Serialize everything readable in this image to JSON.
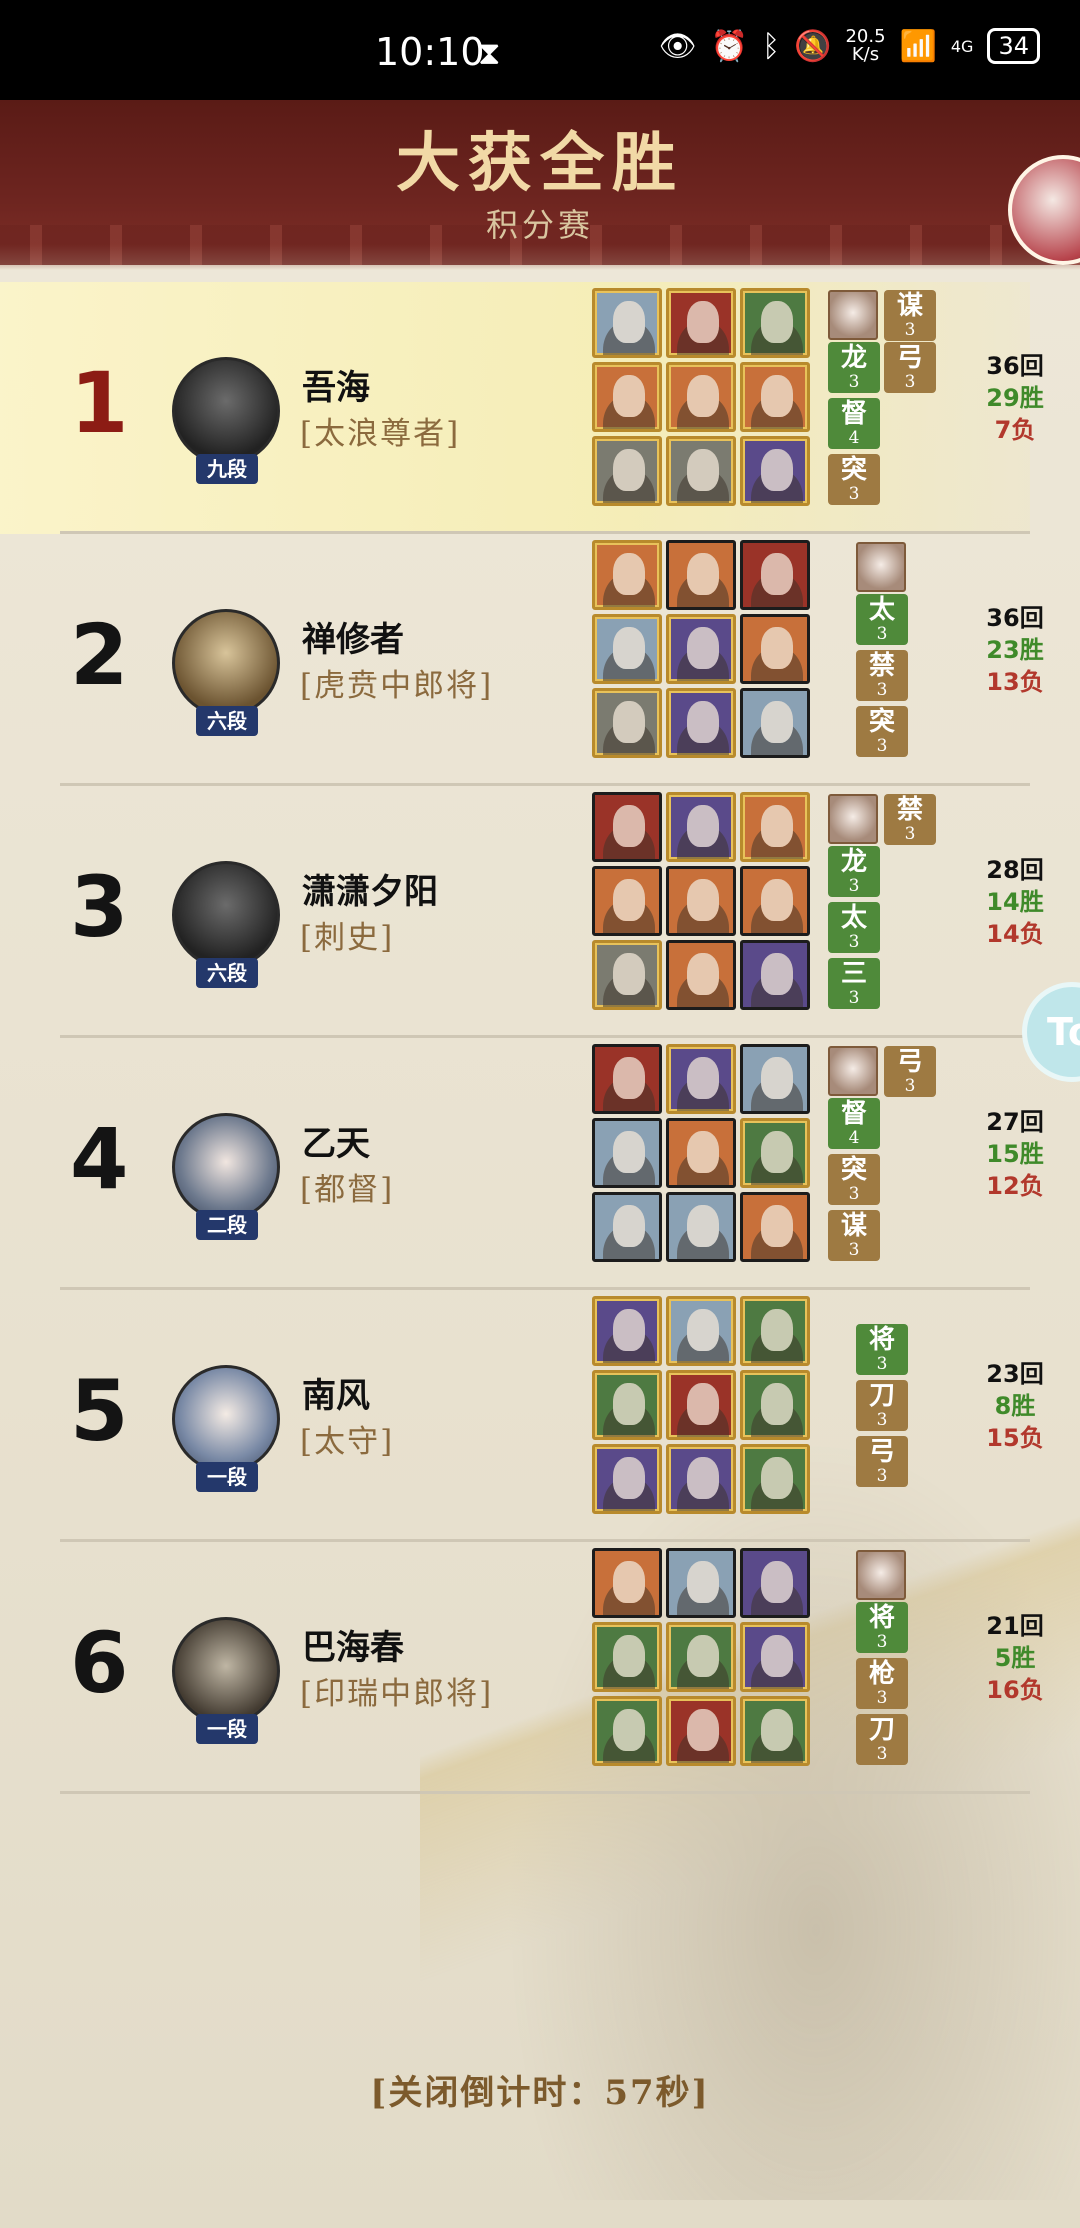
{
  "status_bar": {
    "time": "10:10",
    "net_speed_top": "20.5",
    "net_speed_bottom": "K/s",
    "signal": "4G",
    "battery": "34"
  },
  "header": {
    "title": "大获全胜",
    "subtitle": "积分赛"
  },
  "players": [
    {
      "rank": "1",
      "name": "吾海",
      "title": "[太浪尊者]",
      "dan": "九段",
      "rounds": "36回",
      "wins": "29胜",
      "losses": "7负",
      "tags": [
        {
          "label": "谋",
          "count": "3",
          "color": "brown"
        },
        {
          "label": "弓",
          "count": "3",
          "color": "brown"
        },
        {
          "label": "龙",
          "count": "3",
          "color": "green"
        },
        {
          "label": "督",
          "count": "4",
          "color": "green"
        },
        {
          "label": "突",
          "count": "3",
          "color": "brown"
        }
      ]
    },
    {
      "rank": "2",
      "name": "禅修者",
      "title": "[虎贲中郎将]",
      "dan": "六段",
      "rounds": "36回",
      "wins": "23胜",
      "losses": "13负",
      "tags": [
        {
          "label": "太",
          "count": "3",
          "color": "green"
        },
        {
          "label": "禁",
          "count": "3",
          "color": "brown"
        },
        {
          "label": "突",
          "count": "3",
          "color": "brown"
        }
      ]
    },
    {
      "rank": "3",
      "name": "潇潇夕阳",
      "title": "[刺史]",
      "dan": "六段",
      "rounds": "28回",
      "wins": "14胜",
      "losses": "14负",
      "tags": [
        {
          "label": "禁",
          "count": "3",
          "color": "brown"
        },
        {
          "label": "龙",
          "count": "3",
          "color": "green"
        },
        {
          "label": "太",
          "count": "3",
          "color": "green"
        },
        {
          "label": "三",
          "count": "3",
          "color": "green"
        }
      ]
    },
    {
      "rank": "4",
      "name": "乙天",
      "title": "[都督]",
      "dan": "二段",
      "rounds": "27回",
      "wins": "15胜",
      "losses": "12负",
      "tags": [
        {
          "label": "弓",
          "count": "3",
          "color": "brown"
        },
        {
          "label": "督",
          "count": "4",
          "color": "green"
        },
        {
          "label": "突",
          "count": "3",
          "color": "brown"
        },
        {
          "label": "谋",
          "count": "3",
          "color": "brown"
        }
      ]
    },
    {
      "rank": "5",
      "name": "南风",
      "title": "[太守]",
      "dan": "一段",
      "rounds": "23回",
      "wins": "8胜",
      "losses": "15负",
      "tags": [
        {
          "label": "将",
          "count": "3",
          "color": "green"
        },
        {
          "label": "刀",
          "count": "3",
          "color": "brown"
        },
        {
          "label": "弓",
          "count": "3",
          "color": "brown"
        }
      ]
    },
    {
      "rank": "6",
      "name": "巴海春",
      "title": "[印瑞中郎将]",
      "dan": "一段",
      "rounds": "21回",
      "wins": "5胜",
      "losses": "16负",
      "tags": [
        {
          "label": "将",
          "count": "3",
          "color": "green"
        },
        {
          "label": "枪",
          "count": "3",
          "color": "brown"
        },
        {
          "label": "刀",
          "count": "3",
          "color": "brown"
        }
      ]
    }
  ],
  "countdown": "[关闭倒计时：57秒]",
  "float_button": "To"
}
